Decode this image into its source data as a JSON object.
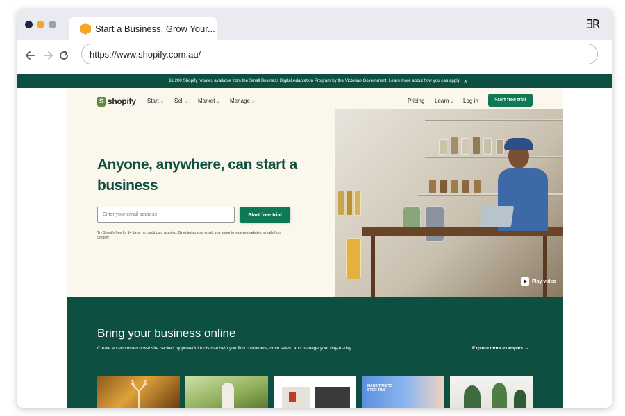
{
  "browser": {
    "tab_title": "Start a Business, Grow Your...",
    "url": "https://www.shopify.com.au/",
    "brand_mark": "ƎR",
    "nav_icons": [
      "back-arrow-icon",
      "forward-arrow-icon",
      "reload-icon"
    ],
    "dot_colors": [
      "#1f2340",
      "#f5a623",
      "#9aa0b8"
    ]
  },
  "banner": {
    "text": "$1,200 Shopify rebates available from the Small Business Digital Adaptation Program by the Victorian Government.",
    "link": "Learn more about how you can apply.",
    "close": "×"
  },
  "header": {
    "logo": "shopify",
    "nav": [
      {
        "label": "Start",
        "chevron": "⌄"
      },
      {
        "label": "Sell",
        "chevron": "⌄"
      },
      {
        "label": "Market",
        "chevron": "⌄"
      },
      {
        "label": "Manage",
        "chevron": "⌄"
      }
    ],
    "pricing": "Pricing",
    "learn": {
      "label": "Learn",
      "chevron": "⌄"
    },
    "login": "Log in",
    "cta": "Start free trial"
  },
  "hero": {
    "headline": "Anyone, anywhere, can start a business",
    "email_placeholder": "Enter your email address",
    "cta": "Start free trial",
    "disclaimer": "Try Shopify free for 14 days, no credit card required. By entering your email, you agree to receive marketing emails from Shopify.",
    "play_label": "Play video"
  },
  "section": {
    "title": "Bring your business online",
    "description": "Create an ecommerce website backed by powerful tools that help you find customers, drive sales, and manage your day-to-day.",
    "explore": "Explore more examples →",
    "thumb_texts": [
      "MAKE TIME TO STOP TIME"
    ]
  },
  "colors": {
    "brand_green": "#0d4f40",
    "button_green": "#0d7a55",
    "hero_bg": "#fbf7ed"
  }
}
